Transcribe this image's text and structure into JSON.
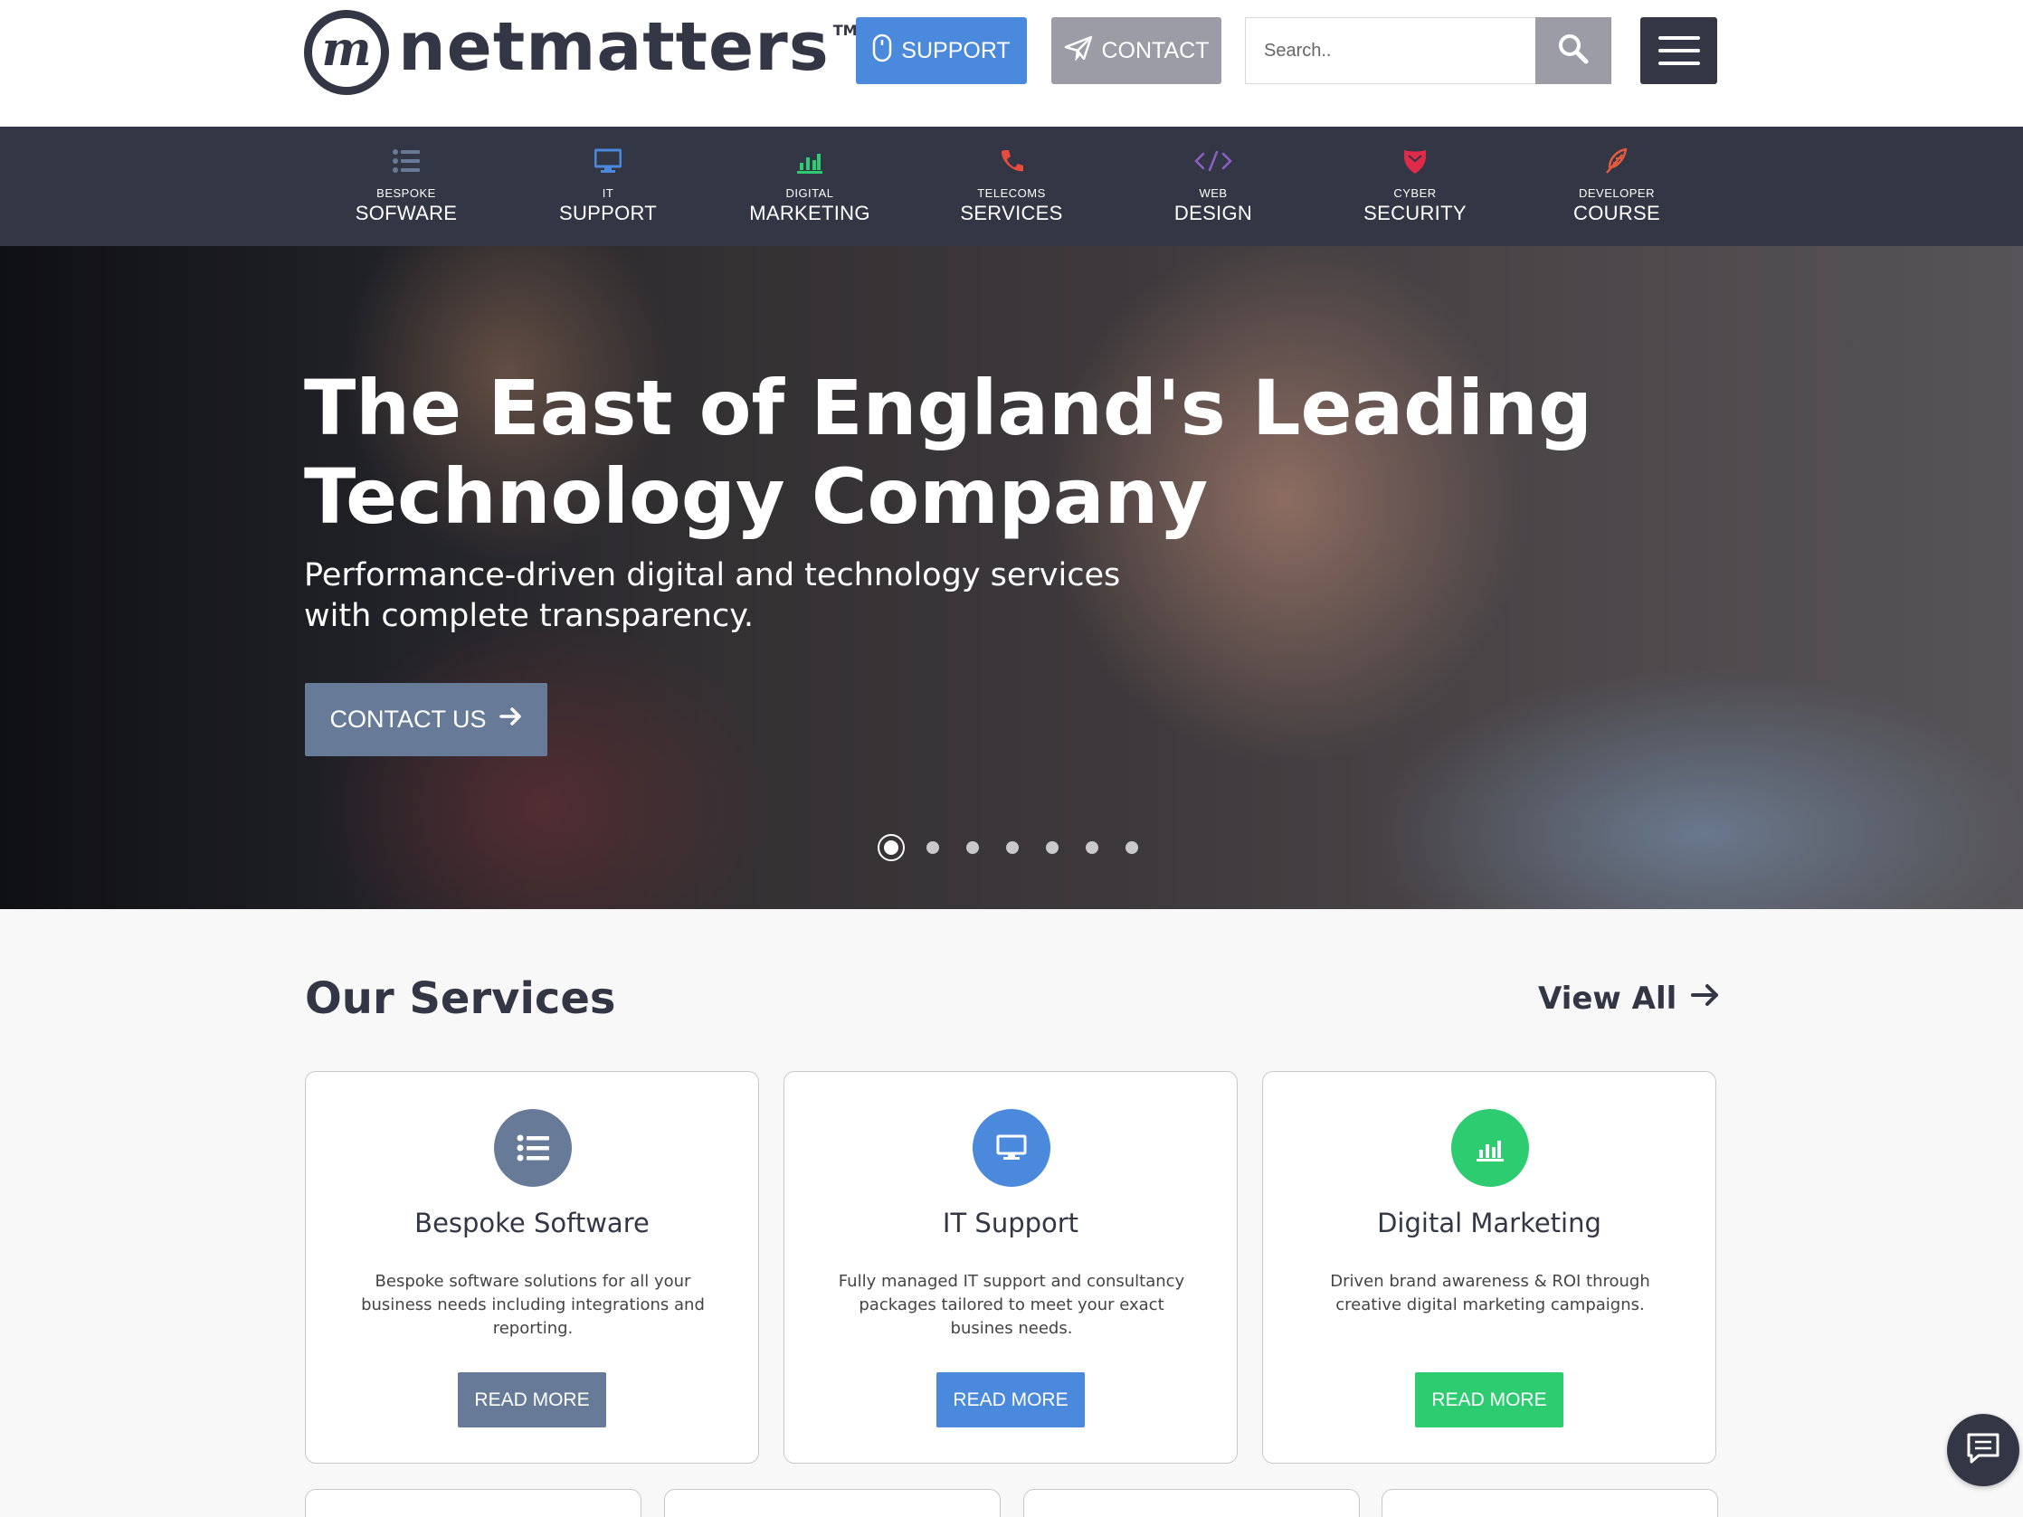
{
  "header": {
    "logo_text": "netmatters",
    "logo_mark": "m",
    "logo_tm": "TM",
    "support_label": "SUPPORT",
    "contact_label": "CONTACT",
    "search_placeholder": "Search..",
    "icons": {
      "support": "mouse-icon",
      "contact": "paper-plane-icon",
      "search": "search-icon",
      "menu": "hamburger-menu-icon"
    },
    "colors": {
      "brand_dark": "#333645",
      "support_blue": "#4a89dc",
      "contact_grey": "#9b9ca5"
    }
  },
  "nav": {
    "items": [
      {
        "small": "BESPOKE",
        "big": "SOFWARE",
        "icon": "list-icon",
        "color": "#677b99"
      },
      {
        "small": "IT",
        "big": "SUPPORT",
        "icon": "desktop-icon",
        "color": "#4a89dc"
      },
      {
        "small": "DIGITAL",
        "big": "MARKETING",
        "icon": "bar-chart-icon",
        "color": "#2ecc71"
      },
      {
        "small": "TELECOMS",
        "big": "SERVICES",
        "icon": "phone-icon",
        "color": "#e74c3c"
      },
      {
        "small": "WEB",
        "big": "DESIGN",
        "icon": "code-icon",
        "color": "#8f5fc6"
      },
      {
        "small": "CYBER",
        "big": "SECURITY",
        "icon": "shield-icon",
        "color": "#e02a4a"
      },
      {
        "small": "DEVELOPER",
        "big": "COURSE",
        "icon": "feather-icon",
        "color": "#e35b3e"
      }
    ]
  },
  "hero": {
    "title_line1": "The East of England's Leading",
    "title_line2": "Technology Company",
    "subtitle_line1": "Performance-driven digital and technology services",
    "subtitle_line2": "with complete transparency.",
    "cta_label": "CONTACT US",
    "slide_count": 7,
    "active_slide": 1
  },
  "services": {
    "title": "Our Services",
    "view_all": "View All",
    "cards": [
      {
        "title": "Bespoke Software",
        "text": "Bespoke software solutions for all your business needs including integrations and reporting.",
        "button": "READ MORE",
        "color": "#677b99",
        "icon": "list-icon"
      },
      {
        "title": "IT Support",
        "text": "Fully managed IT support and consultancy packages tailored to meet your exact busines needs.",
        "button": "READ MORE",
        "color": "#4a89dc",
        "icon": "desktop-icon"
      },
      {
        "title": "Digital Marketing",
        "text": "Driven brand awareness & ROI through creative digital marketing campaigns.",
        "button": "READ MORE",
        "color": "#2ecc71",
        "icon": "bar-chart-icon"
      }
    ]
  },
  "chat": {
    "icon": "chat-icon"
  }
}
